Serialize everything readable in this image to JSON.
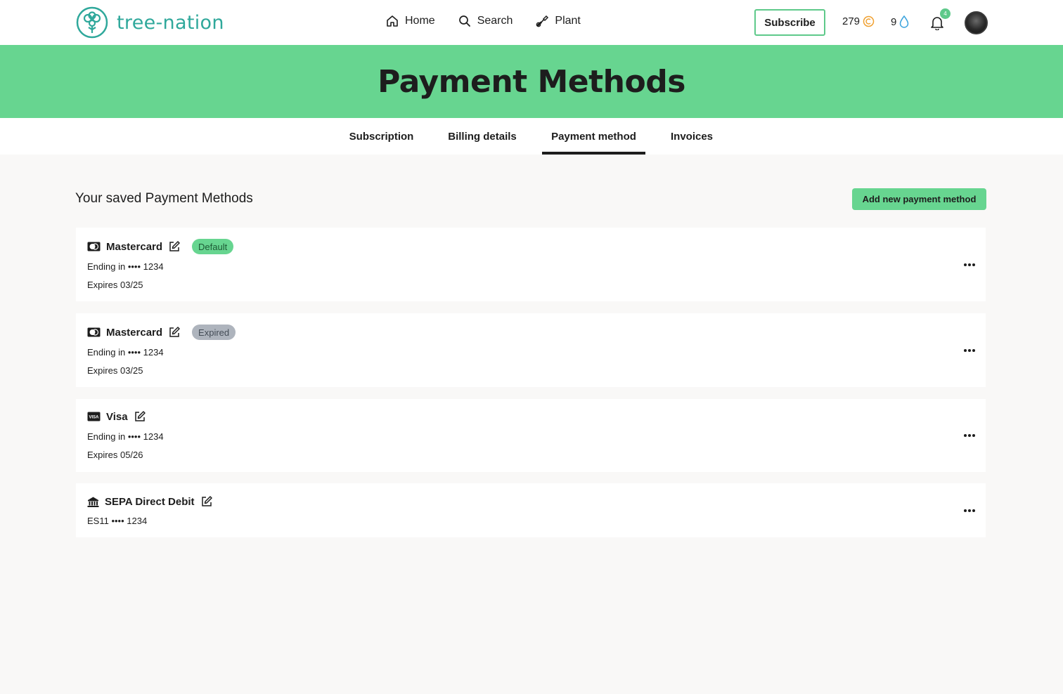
{
  "brand": {
    "name": "tree-nation",
    "color": "#2fa89b"
  },
  "nav": {
    "home": "Home",
    "search": "Search",
    "plant": "Plant"
  },
  "header": {
    "subscribe": "Subscribe",
    "coins": "279",
    "drops": "9",
    "notifications_count": "4"
  },
  "banner": {
    "title": "Payment Methods",
    "color": "#67d590"
  },
  "tabs": [
    {
      "label": "Subscription",
      "active": false
    },
    {
      "label": "Billing details",
      "active": false
    },
    {
      "label": "Payment method",
      "active": true
    },
    {
      "label": "Invoices",
      "active": false
    }
  ],
  "section": {
    "title": "Your saved Payment Methods",
    "add_button": "Add new payment method"
  },
  "methods": [
    {
      "icon": "mastercard-icon",
      "name": "Mastercard",
      "badge": "Default",
      "badge_type": "default",
      "line1": "Ending in •••• 1234",
      "line2": "Expires 03/25"
    },
    {
      "icon": "mastercard-icon",
      "name": "Mastercard",
      "badge": "Expired",
      "badge_type": "expired",
      "line1": "Ending in •••• 1234",
      "line2": "Expires 03/25"
    },
    {
      "icon": "visa-icon",
      "name": "Visa",
      "badge": "",
      "badge_type": "",
      "line1": "Ending in •••• 1234",
      "line2": "Expires 05/26"
    },
    {
      "icon": "bank-icon",
      "name": "SEPA Direct Debit",
      "badge": "",
      "badge_type": "",
      "line1": "ES11 •••• 1234",
      "line2": ""
    }
  ]
}
